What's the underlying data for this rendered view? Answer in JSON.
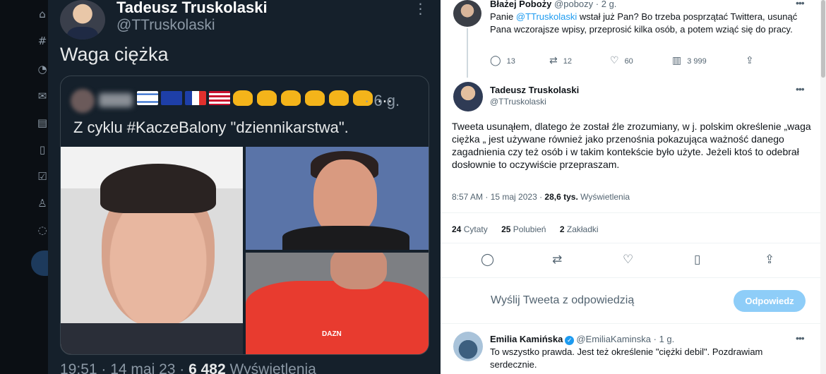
{
  "left_tweet": {
    "author_name": "Tadeusz Truskolaski",
    "author_handle": "@TTruskolaski",
    "more": "⋮",
    "text": "Waga ciężka",
    "quote": {
      "time": "· 6 g.",
      "text": "Z cyklu #KaczeBalony \"dziennikarstwa\".",
      "ellipsis": "…",
      "shirt_print": "DAZN"
    },
    "meta_time": "19:51 · 14 maj 23 ·",
    "meta_views": "6 482",
    "meta_views_label": "Wyświetlenia"
  },
  "reply_above": {
    "author_name": "Błażej Poboży",
    "author_handle": "@pobozy",
    "time": "· 2 g.",
    "text_prefix": "Panie ",
    "mention": "@TTruskolaski",
    "text_suffix": " wstał już Pan? Bo trzeba posprzątać Twittera, usunąć Pana wczorajsze wpisy, przeprosić kilka osób, a potem wziąć się do pracy.",
    "replies": "13",
    "retweets": "12",
    "likes": "60",
    "views": "3 999"
  },
  "main_tweet": {
    "author_name": "Tadeusz Truskolaski",
    "author_handle": "@TTruskolaski",
    "text": "Tweeta usunąłem, dlatego że został źle zrozumiany, w j. polskim określenie „waga ciężka „ jest używane również jako przenośnia pokazująca ważność danego zagadnienia czy też osób i w takim kontekście było użyte. Jeżeli ktoś to odebrał dosłownie to oczywiście przepraszam.",
    "time": "8:57 AM · 15 maj 2023 ·",
    "views_count": "28,6 tys.",
    "views_label": "Wyświetlenia",
    "quotes_count": "24",
    "quotes_label": "Cytaty",
    "likes_count": "25",
    "likes_label": "Polubień",
    "bookmarks_count": "2",
    "bookmarks_label": "Zakładki"
  },
  "reply_box": {
    "placeholder": "Wyślij Tweeta z odpowiedzią",
    "button": "Odpowiedz"
  },
  "reply_below": {
    "author_name": "Emilia Kamińska",
    "author_handle": "@EmiliaKaminska",
    "time": "· 1 g.",
    "text": "To wszystko prawda. Jest też określenie \"ciężki debil\". Pozdrawiam serdecznie."
  },
  "icons": {
    "reply": "reply-icon",
    "retweet": "retweet-icon",
    "like": "heart-icon",
    "views": "views-icon",
    "share": "share-icon",
    "bookmark": "bookmark-icon"
  },
  "colors": {
    "dark_bg": "#15202b",
    "accent": "#1d9bf0",
    "reply_button": "#8ecdf8"
  }
}
